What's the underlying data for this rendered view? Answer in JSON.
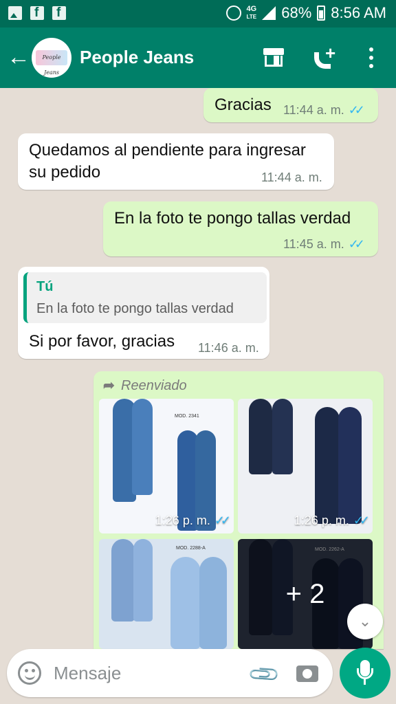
{
  "status_bar": {
    "network": "4G",
    "network_sub": "LTE",
    "battery": "68%",
    "time": "8:56 AM"
  },
  "header": {
    "title": "People Jeans",
    "avatar_text": "People Jeans"
  },
  "messages": [
    {
      "direction": "out",
      "text": "Gracias",
      "time": "11:44 a. m."
    },
    {
      "direction": "in",
      "text_line1": "Quedamos al pendiente para ingresar",
      "text_line2": "su pedido",
      "time": "11:44 a. m."
    },
    {
      "direction": "out",
      "text": "En la foto te pongo tallas verdad",
      "time": "11:45 a. m."
    },
    {
      "direction": "in",
      "quote_author": "Tú",
      "quote_text": "En la foto te pongo tallas verdad",
      "text": "Si por favor, gracias",
      "time": "11:46 a. m."
    }
  ],
  "forwarded": {
    "label": "Reenviado",
    "images": [
      {
        "time": "1:26 p. m.",
        "model": "MOD. 2341"
      },
      {
        "time": "1:26 p. m."
      },
      {
        "model": "MOD. 2288-A"
      },
      {
        "model": "MOD. 2262-A",
        "more": "+ 2"
      }
    ]
  },
  "input": {
    "placeholder": "Mensaje"
  },
  "colors": {
    "header": "#008069",
    "status_bar": "#006c57",
    "outgoing_bubble": "#dcf8c6",
    "incoming_bubble": "#ffffff",
    "wallpaper": "#e5ddd5",
    "read_ticks": "#34b7f1",
    "accent": "#00a884"
  }
}
